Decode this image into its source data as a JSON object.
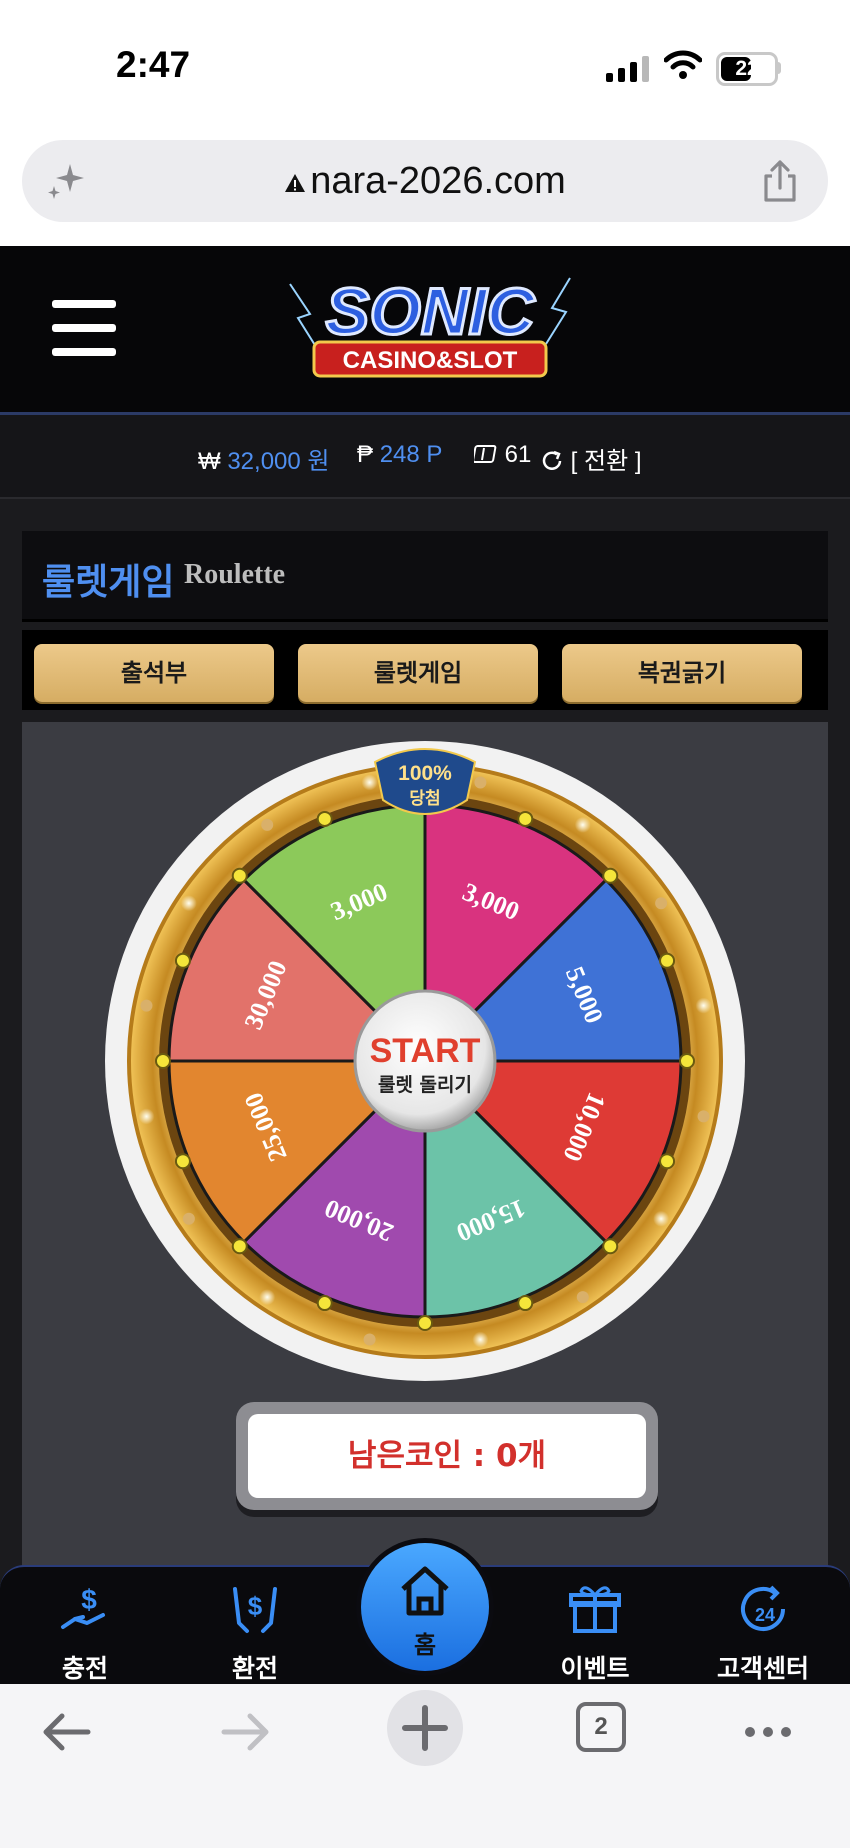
{
  "status": {
    "time": "2:47",
    "battery": "22"
  },
  "browser": {
    "url": "nara-2026.com",
    "tab_count": "2"
  },
  "brand": {
    "logo_main": "SONIC",
    "logo_sub": "CASINO&SLOT"
  },
  "balance": {
    "currency_symbol": "₩",
    "cash": "32,000 원",
    "point_symbol": "₱",
    "points": "248 P",
    "tickets": "61",
    "convert_label": "[ 전환 ]"
  },
  "section": {
    "title_ko": "룰렛게임",
    "title_en": "Roulette"
  },
  "tabs": [
    {
      "label": "출석부"
    },
    {
      "label": "룰렛게임"
    },
    {
      "label": "복권긁기"
    }
  ],
  "wheel": {
    "badge_top": "100%",
    "badge_bottom": "당첨",
    "start": "START",
    "start_sub": "룰렛 돌리기",
    "segments": [
      {
        "label": "3,000",
        "color": "#d9337f"
      },
      {
        "label": "5,000",
        "color": "#3f72d6"
      },
      {
        "label": "10,000",
        "color": "#de3a35"
      },
      {
        "label": "15,000",
        "color": "#6cc3a8"
      },
      {
        "label": "20,000",
        "color": "#a04aae"
      },
      {
        "label": "25,000",
        "color": "#e2862f"
      },
      {
        "label": "30,000",
        "color": "#e2726a"
      },
      {
        "label": "3,000",
        "color": "#8cc95a"
      }
    ]
  },
  "coins": {
    "label": "남은코인 : 0개"
  },
  "nav": [
    {
      "label": "충전"
    },
    {
      "label": "환전"
    },
    {
      "label": "홈"
    },
    {
      "label": "이벤트"
    },
    {
      "label": "고객센터"
    }
  ],
  "colors": {
    "accent": "#4f8ff0",
    "gold": "#e0b468",
    "nav_blue": "#3a8ef5"
  }
}
